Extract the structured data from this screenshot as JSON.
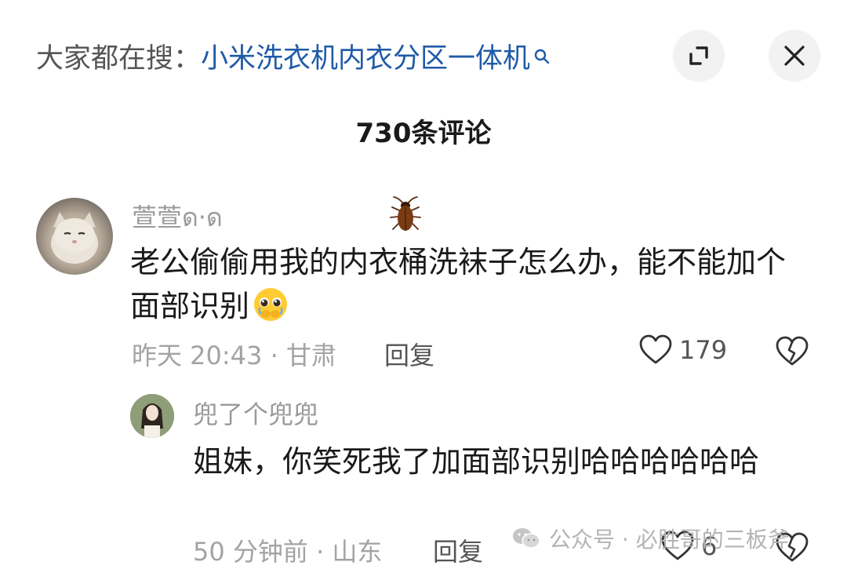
{
  "header": {
    "search_prefix": "大家都在搜：",
    "search_term": "小米洗衣机内衣分区一体机",
    "search_icon": "search-icon",
    "expand_icon": "expand-icon",
    "close_icon": "close-icon"
  },
  "comments_header": {
    "count_label": "730条评论"
  },
  "comments": [
    {
      "username": "萱萱ด‧ด",
      "text": "老公偷偷用我的内衣桶洗袜子怎么办，能不能加个面部识别",
      "emoji": "pleading-face-emoji",
      "decoration": "cockroach-icon",
      "meta": "昨天 20:43 · 甘肃",
      "reply_label": "回复",
      "likes": "179"
    },
    {
      "username": "兜了个兜兜",
      "text": "姐妹，你笑死我了加面部识别哈哈哈哈哈哈",
      "meta": "50 分钟前 · 山东",
      "reply_label": "回复",
      "likes": "6"
    }
  ],
  "watermark": {
    "text": "公众号 · 必胜哥的三板斧",
    "icon": "wechat-icon"
  },
  "colors": {
    "link_blue": "#1f5aa8",
    "muted_gray": "#9a9a9a",
    "button_bg": "#f2f2f2"
  }
}
